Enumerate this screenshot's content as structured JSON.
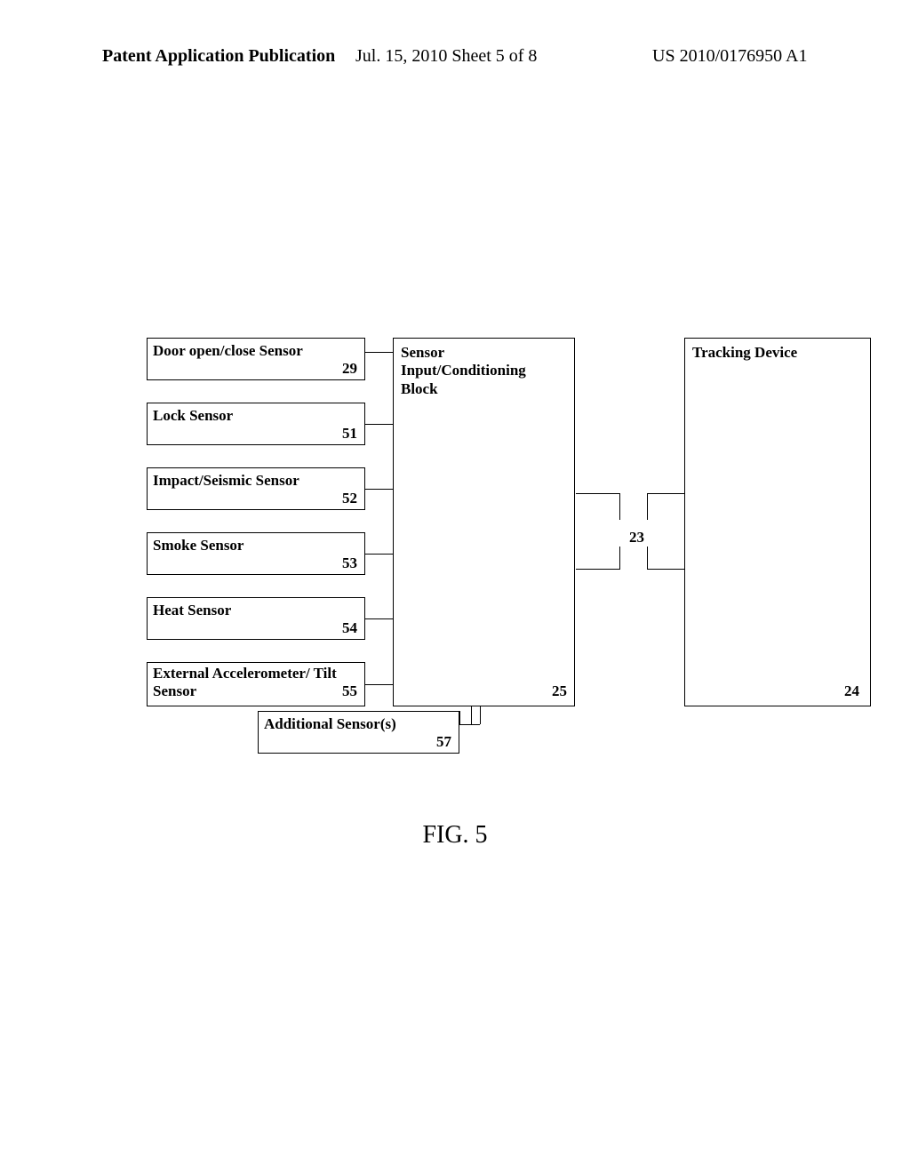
{
  "header": {
    "left": "Patent Application Publication",
    "center": "Jul. 15, 2010  Sheet 5 of 8",
    "right": "US 2010/0176950 A1"
  },
  "sensors": [
    {
      "label": "Door open/close Sensor",
      "num": "29"
    },
    {
      "label": "Lock Sensor",
      "num": "51"
    },
    {
      "label": "Impact/Seismic Sensor",
      "num": "52"
    },
    {
      "label": "Smoke Sensor",
      "num": "53"
    },
    {
      "label": "Heat Sensor",
      "num": "54"
    },
    {
      "label": "External Accelerometer/ Tilt Sensor",
      "num": "55"
    }
  ],
  "additional": {
    "label": "Additional Sensor(s)",
    "num": "57"
  },
  "cond": {
    "label": "Sensor Input/Conditioning Block",
    "num": "25"
  },
  "track": {
    "label": "Tracking Device",
    "num": "24"
  },
  "bus_label": "23",
  "figure_label": "FIG. 5"
}
